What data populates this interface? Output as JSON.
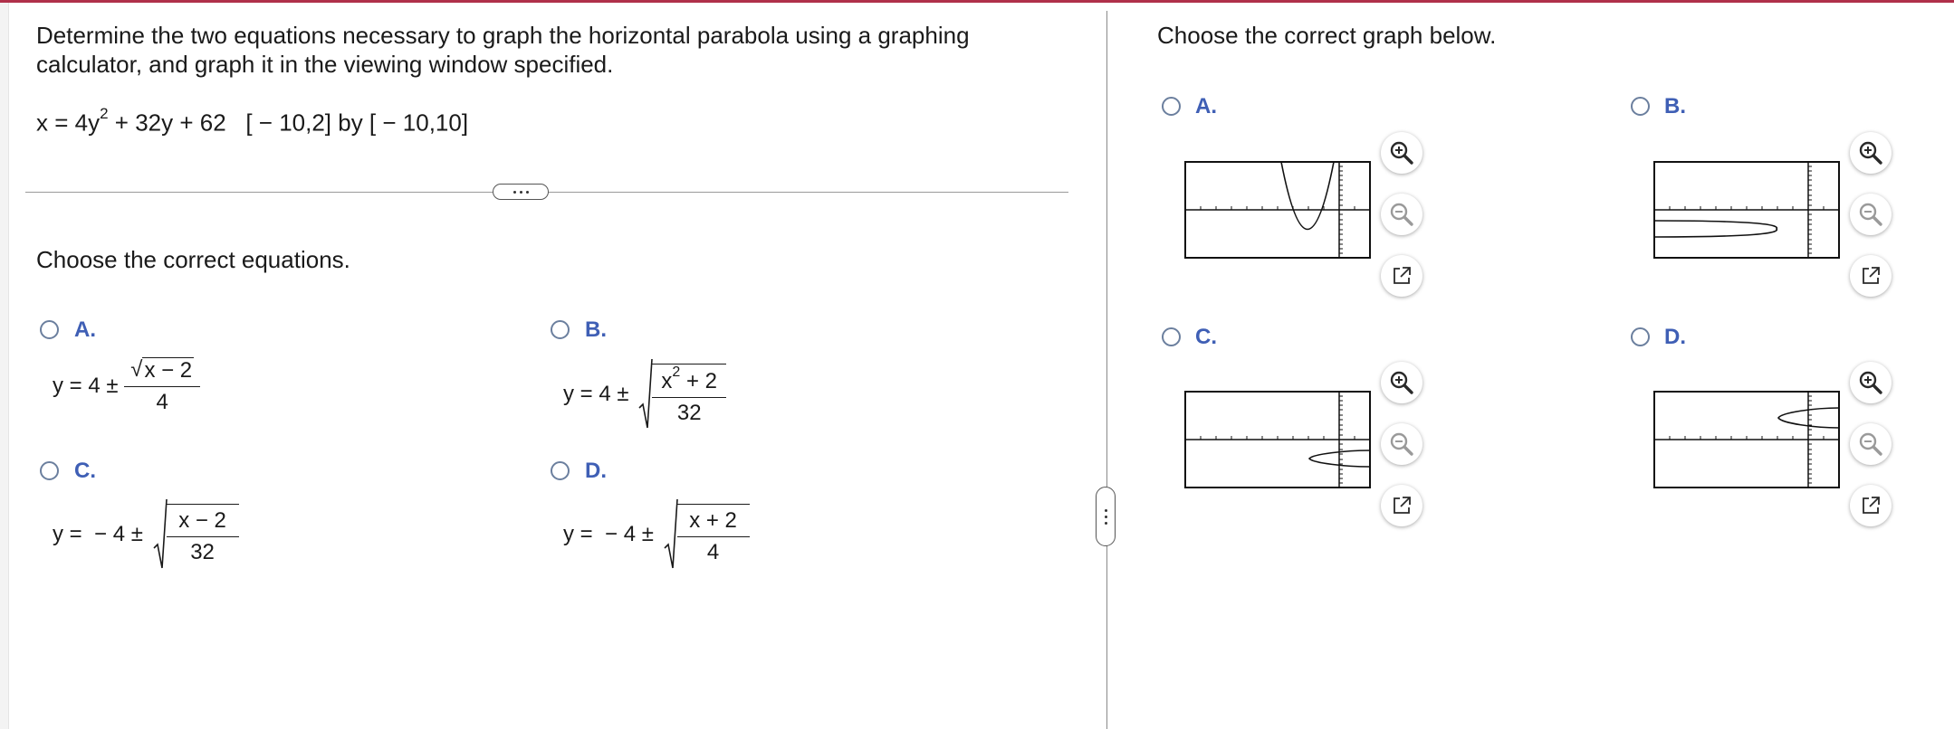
{
  "question": {
    "instruction": "Determine the two equations necessary to graph the horizontal parabola using a graphing calculator, and graph it in the viewing window specified.",
    "equation": {
      "lhs": "x = 4y",
      "exp": "2",
      "rhs": " + 32y + 62   [ − 10,2] by [ − 10,10]"
    }
  },
  "part1": {
    "prompt": "Choose the correct equations.",
    "options": [
      {
        "letter": "A.",
        "prefix": "y = 4 ±",
        "num": "x − 2",
        "den": "4"
      },
      {
        "letter": "B.",
        "prefix": "y = 4 ±",
        "num": "x",
        "num_exp": "2",
        "num_tail": " + 2",
        "den": "32"
      },
      {
        "letter": "C.",
        "prefix": "y =  − 4 ±",
        "num": "x − 2",
        "den": "32"
      },
      {
        "letter": "D.",
        "prefix": "y =  − 4 ±",
        "num": "x + 2",
        "den": "4"
      }
    ]
  },
  "part2": {
    "prompt": "Choose the correct graph below.",
    "options": [
      {
        "letter": "A."
      },
      {
        "letter": "B."
      },
      {
        "letter": "C."
      },
      {
        "letter": "D."
      }
    ],
    "tools": {
      "zoom_in_icon": "magnifier-plus-icon",
      "zoom_out_icon": "magnifier-minus-icon",
      "popout_icon": "external-link-icon"
    }
  },
  "colors": {
    "accent": "#3f5fb5",
    "top_bar": "#b0304a",
    "radio_border": "#6b7f9e",
    "zoom_icon": "#2a2a2a"
  }
}
